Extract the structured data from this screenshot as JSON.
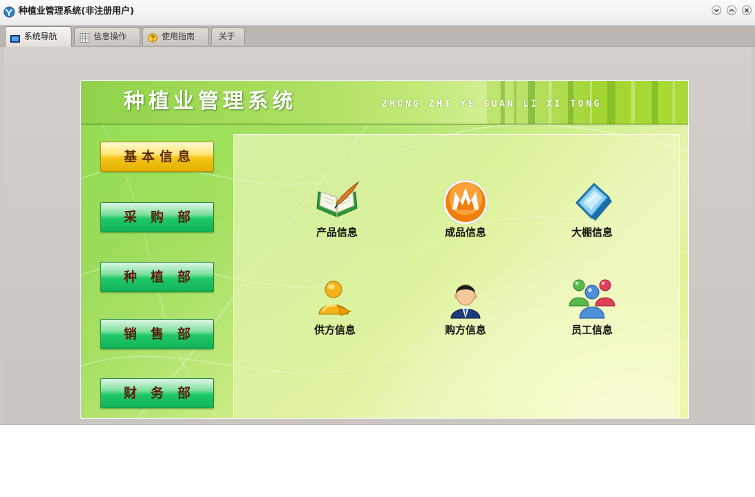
{
  "window": {
    "title": "种植业管理系统(非注册用户)"
  },
  "tabs": [
    {
      "label": "系统导航",
      "icon": "monitor-icon",
      "active": true
    },
    {
      "label": "信息操作",
      "icon": "grid-icon",
      "active": false
    },
    {
      "label": "使用指南",
      "icon": "help-icon",
      "active": false
    },
    {
      "label": "关于",
      "icon": "",
      "active": false
    }
  ],
  "header": {
    "title": "种植业管理系统",
    "subtitle": "ZHONG ZHI YE GUAN LI XI TONG"
  },
  "side_menu": [
    {
      "label": "基本信息",
      "active": true
    },
    {
      "label": "采购部",
      "active": false
    },
    {
      "label": "种植部",
      "active": false
    },
    {
      "label": "销售部",
      "active": false
    },
    {
      "label": "财务部",
      "active": false
    }
  ],
  "features": [
    {
      "label": "产品信息",
      "icon": "open-book-quill-icon"
    },
    {
      "label": "成品信息",
      "icon": "orange-crown-orb-icon"
    },
    {
      "label": "大棚信息",
      "icon": "blue-book-icon"
    },
    {
      "label": "供方信息",
      "icon": "gold-user-icon"
    },
    {
      "label": "购方信息",
      "icon": "businessman-icon"
    },
    {
      "label": "员工信息",
      "icon": "user-group-icon"
    }
  ],
  "colors": {
    "panel_green": "#a6e063",
    "menu_green": "#1fc866",
    "menu_gold": "#f2c417",
    "menu_text": "#5a1a06"
  }
}
